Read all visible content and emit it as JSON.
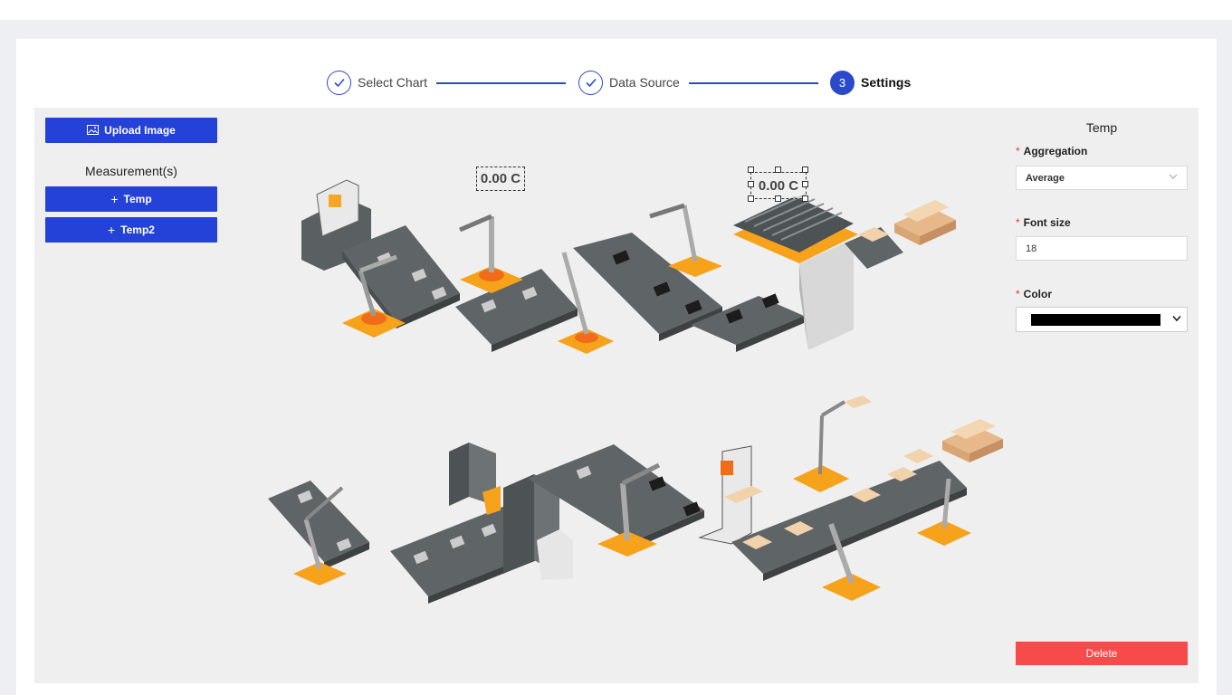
{
  "stepper": {
    "steps": [
      {
        "label": "Select Chart",
        "status": "done"
      },
      {
        "label": "Data Source",
        "status": "done"
      },
      {
        "number": "3",
        "label": "Settings",
        "status": "active"
      }
    ]
  },
  "left_panel": {
    "upload_label": "Upload Image",
    "measurements_title": "Measurement(s)",
    "measurements": [
      {
        "label": "Temp"
      },
      {
        "label": "Temp2"
      }
    ]
  },
  "canvas": {
    "labels": [
      {
        "text": "0.00 C",
        "selected": false
      },
      {
        "text": "0.00 C",
        "selected": true
      }
    ]
  },
  "right_panel": {
    "title": "Temp",
    "aggregation_label": "Aggregation",
    "aggregation_value": "Average",
    "font_size_label": "Font size",
    "font_size_value": "18",
    "color_label": "Color",
    "color_value": "#000000",
    "delete_label": "Delete"
  },
  "colors": {
    "primary": "#2441d8",
    "danger": "#f74a4a",
    "machine_gray": "#5f6466",
    "accent_orange": "#f7a21b"
  },
  "icons": [
    "check-icon",
    "image-icon",
    "plus-icon",
    "chevron-down-icon"
  ]
}
